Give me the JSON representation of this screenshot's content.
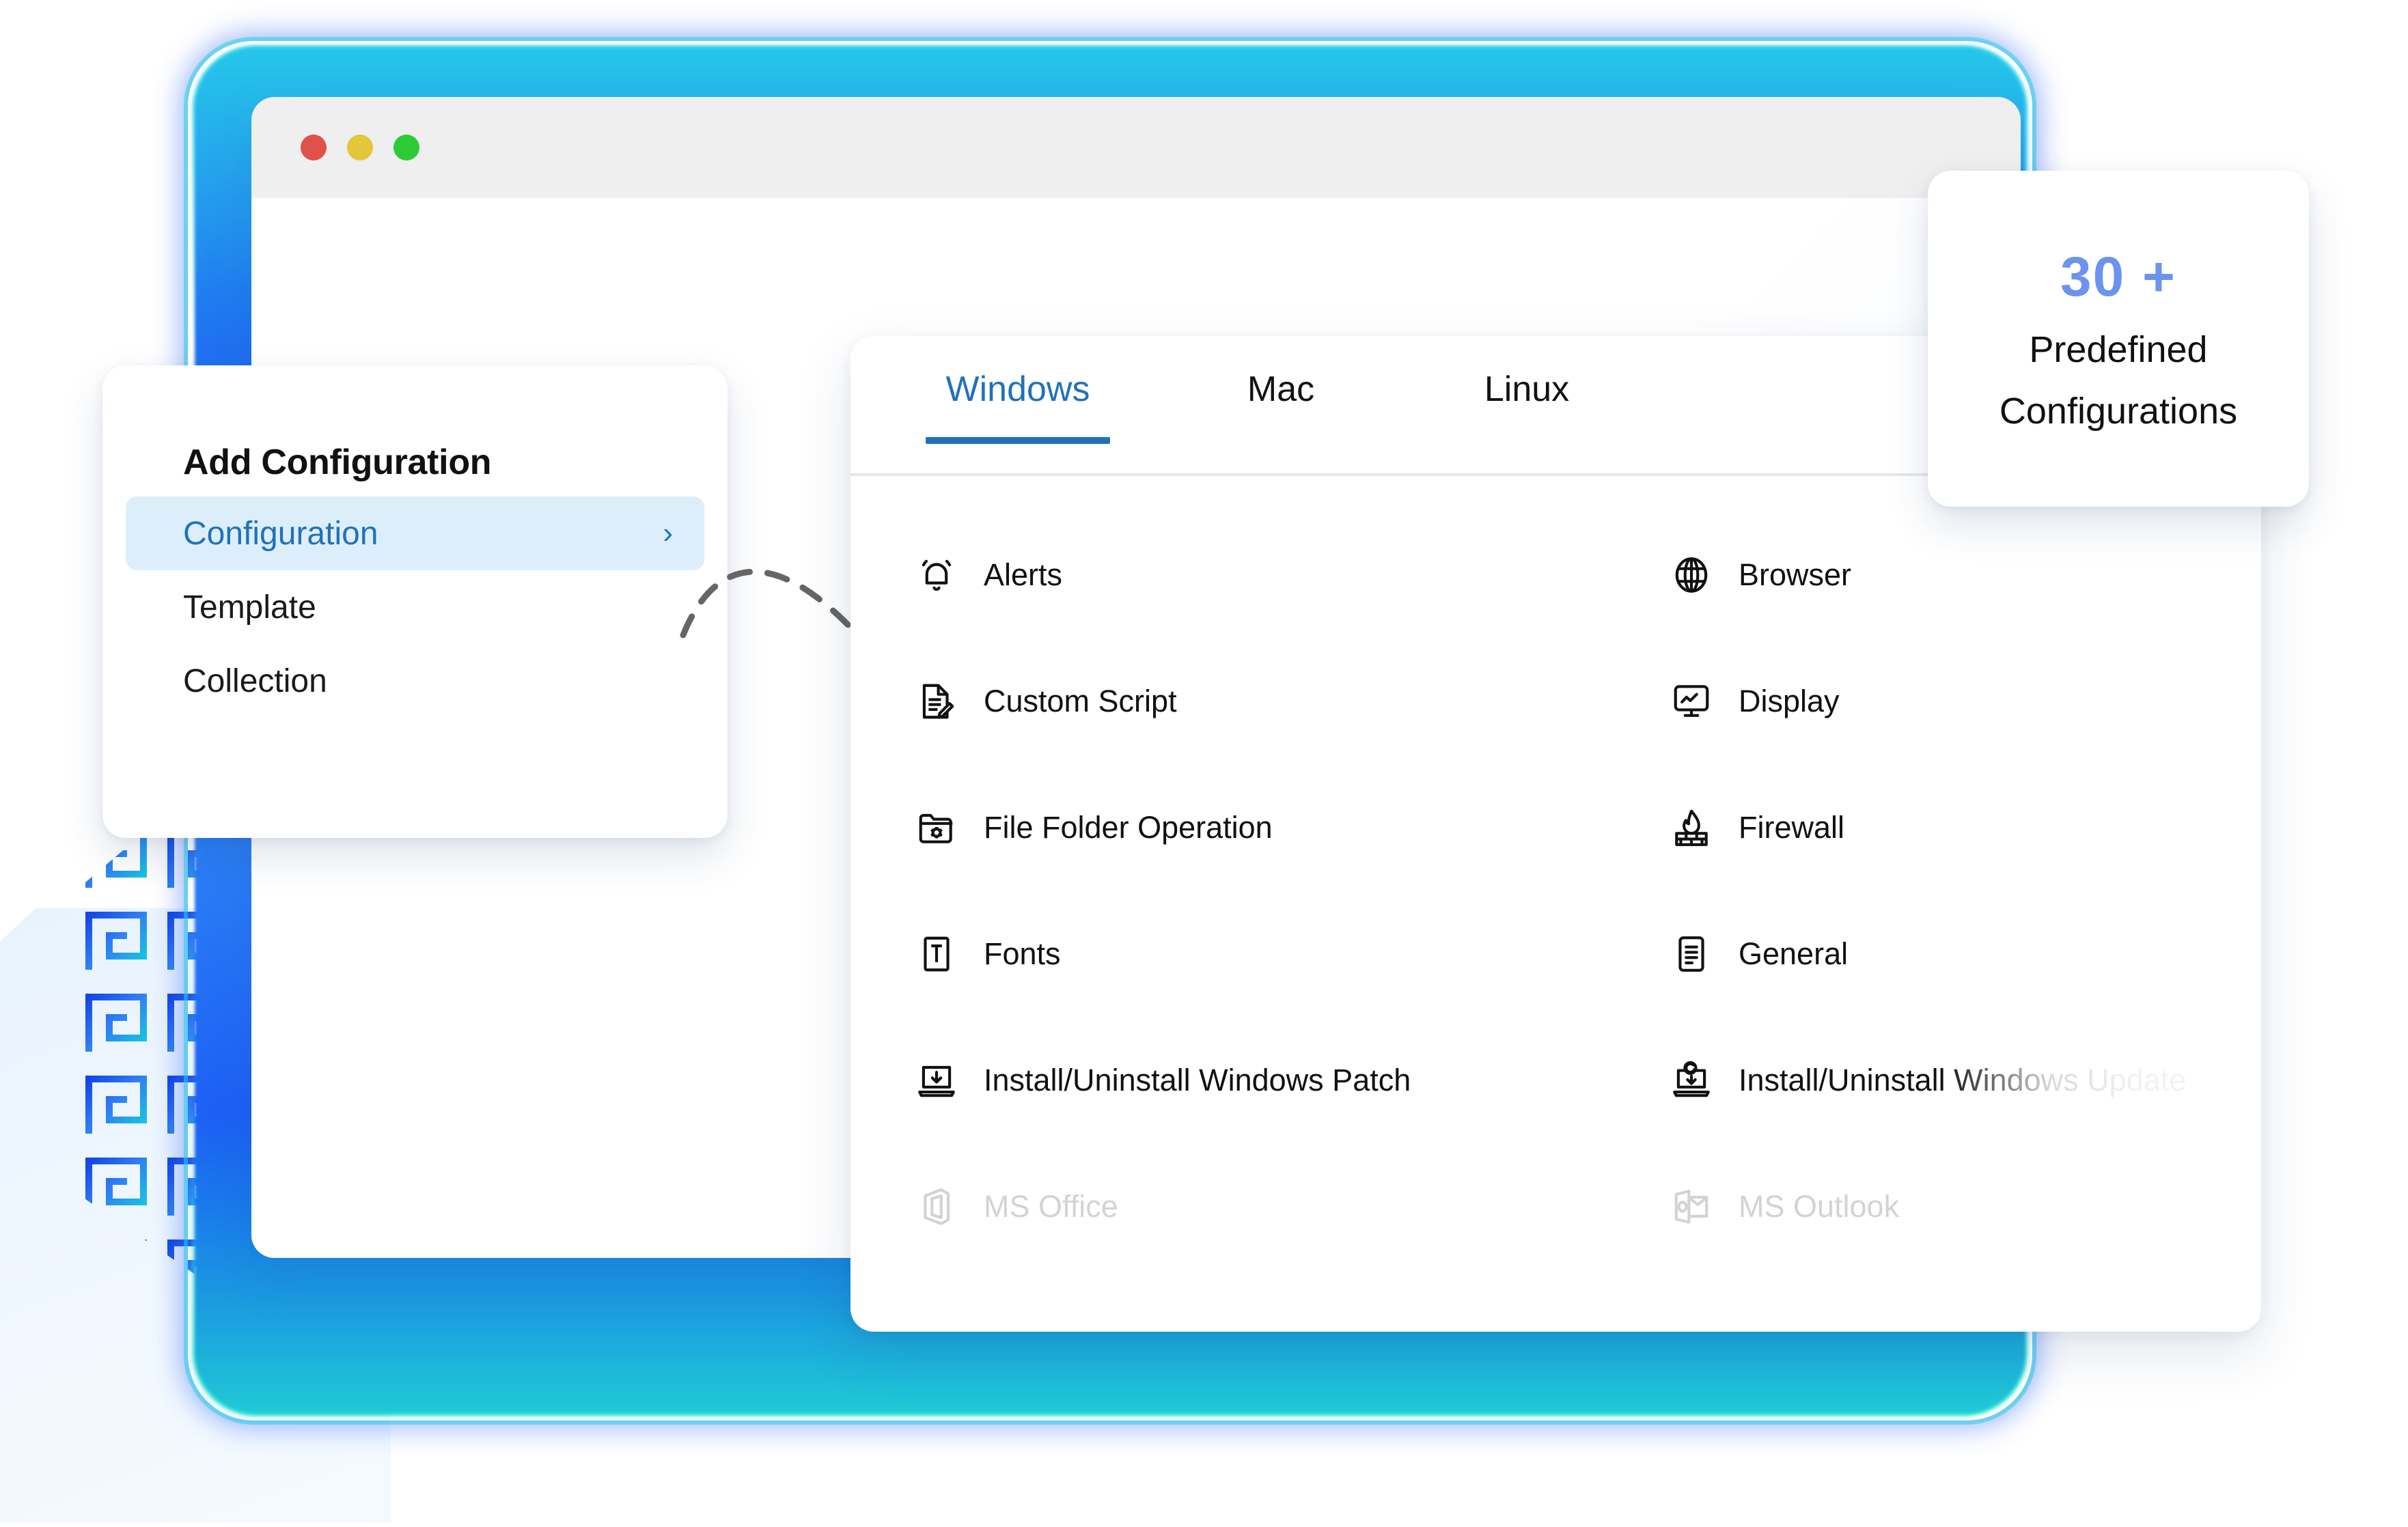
{
  "window": {
    "traffic_lights": [
      "close",
      "minimize",
      "maximize"
    ]
  },
  "add_configuration_card": {
    "title": "Add Configuration",
    "items": [
      {
        "label": "Configuration",
        "active": true,
        "chevron": "›"
      },
      {
        "label": "Template",
        "active": false,
        "chevron": ""
      },
      {
        "label": "Collection",
        "active": false,
        "chevron": ""
      }
    ]
  },
  "panel": {
    "tabs": [
      {
        "label": "Windows",
        "active": true
      },
      {
        "label": "Mac",
        "active": false
      },
      {
        "label": "Linux",
        "active": false
      }
    ],
    "rows": [
      {
        "left": {
          "icon": "bell-icon",
          "label": "Alerts",
          "faded": false,
          "clipped": false
        },
        "right": {
          "icon": "globe-icon",
          "label": "Browser",
          "faded": false,
          "clipped": false
        }
      },
      {
        "left": {
          "icon": "script-edit-icon",
          "label": "Custom Script",
          "faded": false,
          "clipped": false
        },
        "right": {
          "icon": "monitor-chart-icon",
          "label": "Display",
          "faded": false,
          "clipped": false
        }
      },
      {
        "left": {
          "icon": "folder-gear-icon",
          "label": "File Folder Operation",
          "faded": false,
          "clipped": false
        },
        "right": {
          "icon": "firewall-flame-icon",
          "label": "Firewall",
          "faded": false,
          "clipped": false
        }
      },
      {
        "left": {
          "icon": "font-t-icon",
          "label": "Fonts",
          "faded": false,
          "clipped": false
        },
        "right": {
          "icon": "document-lines-icon",
          "label": "General",
          "faded": false,
          "clipped": false
        }
      },
      {
        "left": {
          "icon": "laptop-download-icon",
          "label": "Install/Uninstall Windows Patch",
          "faded": false,
          "clipped": false
        },
        "right": {
          "icon": "laptop-update-icon",
          "label": "Install/Uninstall Windows Update",
          "faded": false,
          "clipped": true
        }
      },
      {
        "left": {
          "icon": "ms-office-icon",
          "label": "MS Office",
          "faded": true,
          "clipped": false
        },
        "right": {
          "icon": "ms-outlook-icon",
          "label": "MS Outlook",
          "faded": true,
          "clipped": false
        }
      }
    ]
  },
  "badge_card": {
    "number": "30 +",
    "line1": "Predefined",
    "line2": "Configurations"
  },
  "colors": {
    "accent_blue": "#1f72b8",
    "badge_blue": "#6d93f0",
    "active_pill_bg": "#ddeefb",
    "glow_blue": "#1f6ff2",
    "glow_cyan": "#23d4e8",
    "titlebar_gray": "#efefef",
    "dot_red": "#e0514c",
    "dot_yellow": "#e3c73a",
    "dot_green": "#2dcb36"
  }
}
